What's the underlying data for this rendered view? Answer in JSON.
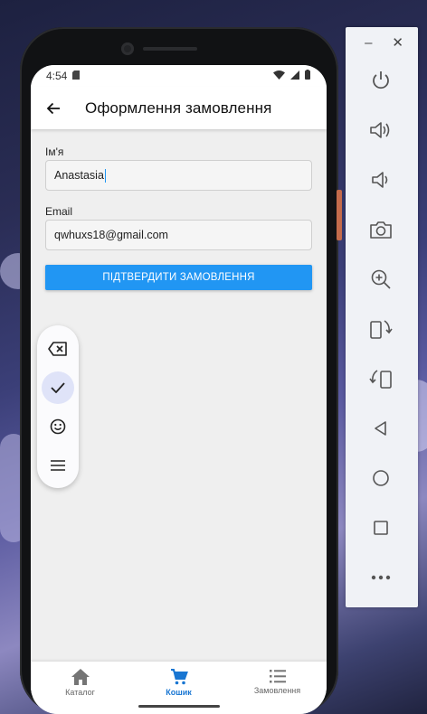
{
  "status_bar": {
    "time": "4:54"
  },
  "app_bar": {
    "title": "Оформлення замовлення"
  },
  "form": {
    "name_label": "Ім'я",
    "name_value": "Anastasia",
    "email_label": "Email",
    "email_value": "qwhuxs18@gmail.com",
    "submit_label": "ПІДТВЕРДИТИ ЗАМОВЛЕННЯ"
  },
  "floating_keyboard": {
    "buttons": [
      "backspace-icon",
      "check-icon",
      "emoji-icon",
      "menu-icon"
    ],
    "active": "check-icon"
  },
  "bottom_nav": {
    "items": [
      {
        "label": "Каталог",
        "icon": "home-icon",
        "active": false
      },
      {
        "label": "Кошик",
        "icon": "cart-icon",
        "active": true
      },
      {
        "label": "Замовлення",
        "icon": "list-icon",
        "active": false
      }
    ]
  },
  "emulator_panel": {
    "window_controls": [
      "minimize-icon",
      "close-icon"
    ],
    "buttons": [
      "power-icon",
      "volume-up-icon",
      "volume-down-icon",
      "camera-icon",
      "zoom-in-icon",
      "rotate-left-icon",
      "rotate-right-icon",
      "back-icon",
      "home-icon",
      "overview-icon",
      "more-icon"
    ]
  },
  "colors": {
    "accent": "#2196f3",
    "nav_active": "#1976d2",
    "screen_bg": "#efefef"
  }
}
